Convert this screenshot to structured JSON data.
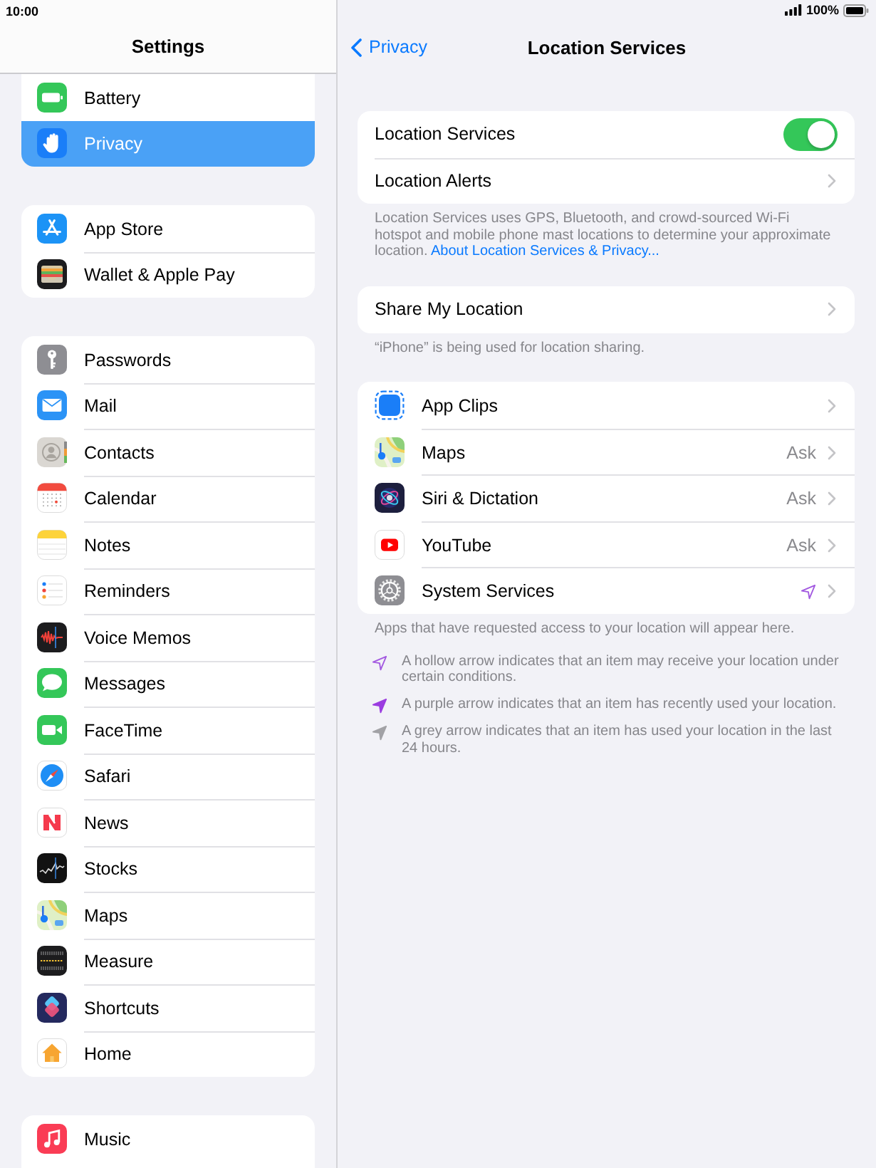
{
  "status_bar": {
    "time": "10:00",
    "battery": "100%"
  },
  "sidebar": {
    "title": "Settings",
    "groups": [
      {
        "items": [
          {
            "label": "Battery",
            "selected": false
          },
          {
            "label": "Privacy",
            "selected": true
          }
        ]
      },
      {
        "items": [
          {
            "label": "App Store",
            "selected": false
          },
          {
            "label": "Wallet & Apple Pay",
            "selected": false
          }
        ]
      },
      {
        "items": [
          {
            "label": "Passwords",
            "selected": false
          },
          {
            "label": "Mail",
            "selected": false
          },
          {
            "label": "Contacts",
            "selected": false
          },
          {
            "label": "Calendar",
            "selected": false
          },
          {
            "label": "Notes",
            "selected": false
          },
          {
            "label": "Reminders",
            "selected": false
          },
          {
            "label": "Voice Memos",
            "selected": false
          },
          {
            "label": "Messages",
            "selected": false
          },
          {
            "label": "FaceTime",
            "selected": false
          },
          {
            "label": "Safari",
            "selected": false
          },
          {
            "label": "News",
            "selected": false
          },
          {
            "label": "Stocks",
            "selected": false
          },
          {
            "label": "Maps",
            "selected": false
          },
          {
            "label": "Measure",
            "selected": false
          },
          {
            "label": "Shortcuts",
            "selected": false
          },
          {
            "label": "Home",
            "selected": false
          }
        ]
      },
      {
        "items": [
          {
            "label": "Music",
            "selected": false
          }
        ]
      }
    ]
  },
  "detail": {
    "back": "Privacy",
    "title": "Location Services",
    "sections": [
      {
        "kind": "plain",
        "rows": [
          {
            "kind": "toggle",
            "label": "Location Services",
            "on": true
          },
          {
            "kind": "link",
            "label": "Location Alerts"
          }
        ],
        "footer": {
          "text": "Location Services uses GPS, Bluetooth, and crowd-sourced Wi-Fi hotspot and mobile phone mast locations to determine your approximate location.",
          "link": "About Location Services & Privacy..."
        }
      },
      {
        "kind": "plain",
        "rows": [
          {
            "kind": "link",
            "label": "Share My Location"
          }
        ],
        "footer": {
          "text": "“iPhone” is being used for location sharing."
        }
      },
      {
        "kind": "apps",
        "rows": [
          {
            "kind": "link",
            "label": "App Clips"
          },
          {
            "kind": "value",
            "label": "Maps",
            "value": "Ask"
          },
          {
            "kind": "value",
            "label": "Siri & Dictation",
            "value": "Ask"
          },
          {
            "kind": "value",
            "label": "YouTube",
            "value": "Ask"
          },
          {
            "kind": "arrow",
            "label": "System Services"
          }
        ],
        "footer": {
          "text": "Apps that have requested access to your location will appear here."
        }
      }
    ],
    "legend": [
      {
        "kind": "hollow",
        "color": "#a258e0",
        "text": "A hollow arrow indicates that an item may receive your location under certain conditions."
      },
      {
        "kind": "filled",
        "color": "#9b3de0",
        "text": "A purple arrow indicates that an item has recently used your location."
      },
      {
        "kind": "filled",
        "color": "#a2a2a6",
        "text": "A grey arrow indicates that an item has used your location in the last 24 hours."
      }
    ]
  }
}
